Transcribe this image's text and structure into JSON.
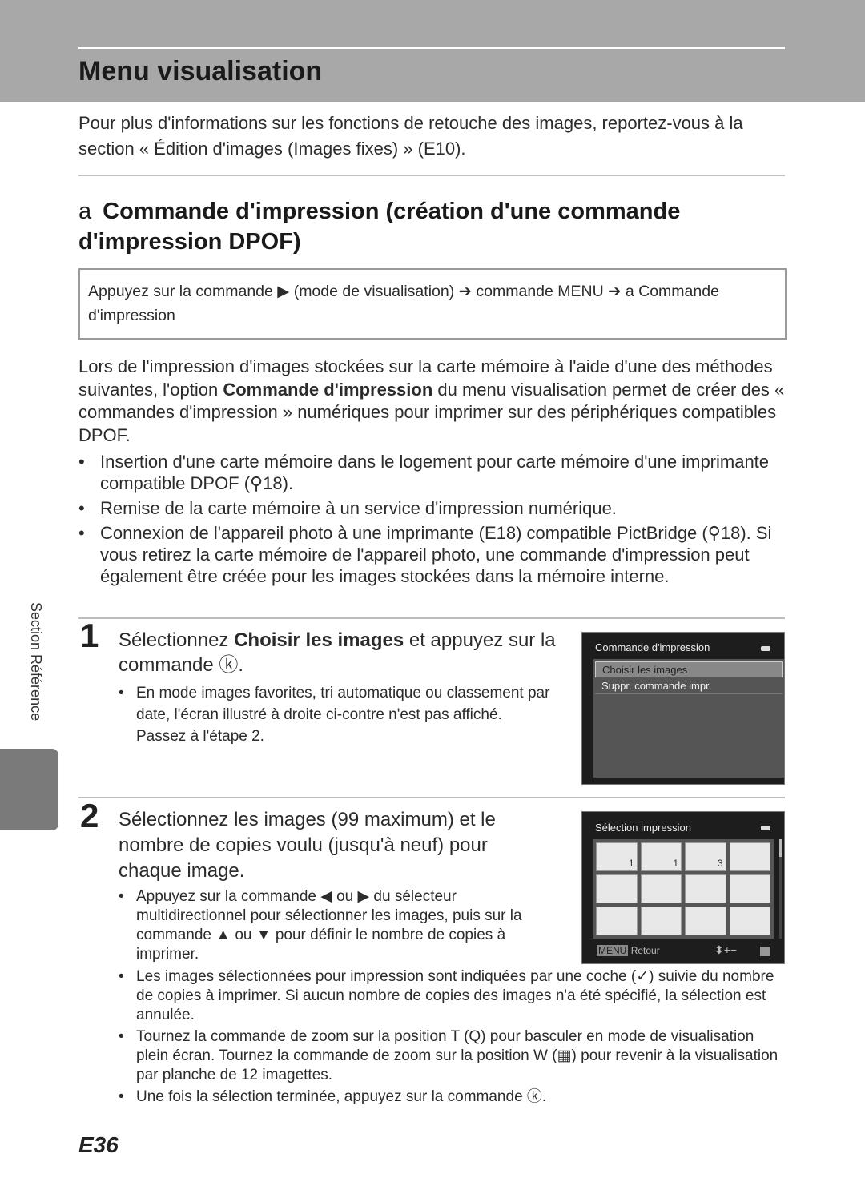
{
  "header": {
    "title": "Menu visualisation"
  },
  "intro": "Pour plus d'informations sur les fonctions de retouche des images, reportez-vous à la section « Édition d'images (Images fixes) » (E10).",
  "section": {
    "icon": "a",
    "title": "Commande d'impression (création d'une commande d'impression DPOF)"
  },
  "path_box": {
    "text": "Appuyez sur la commande ▶ (mode de visualisation) ➔ commande MENU ➔ a  Commande d'impression"
  },
  "desc": {
    "pre": "Lors de l'impression d'images stockées sur la carte mémoire à l'aide d'une des méthodes suivantes, l'option ",
    "bold": "Commande d'impression",
    "post": " du menu visualisation permet de créer des « commandes d'impression » numériques pour imprimer sur des périphériques compatibles DPOF."
  },
  "bullets": [
    "Insertion d'une carte mémoire dans le logement pour carte mémoire d'une imprimante compatible DPOF (⚲18).",
    "Remise de la carte mémoire à un service d'impression numérique.",
    "Connexion de l'appareil photo à une imprimante (E18) compatible PictBridge (⚲18). Si vous retirez la carte mémoire de l'appareil photo, une commande d'impression peut également être créée pour les images stockées dans la mémoire interne."
  ],
  "side_label": "Section Référence",
  "step1": {
    "num": "1",
    "pre": "Sélectionnez ",
    "bold": "Choisir les images",
    "post": " et appuyez sur la commande ⓚ.",
    "notes": [
      "En mode images favorites, tri automatique ou classement par date, l'écran illustré à droite ci-contre n'est pas affiché. Passez à l'étape 2."
    ],
    "screen": {
      "title": "Commande d'impression",
      "items": [
        "Choisir les images",
        "Suppr. commande impr."
      ]
    }
  },
  "step2": {
    "num": "2",
    "heading": "Sélectionnez les images (99 maximum) et le nombre de copies voulu (jusqu'à neuf) pour chaque image.",
    "notes": [
      "Appuyez sur la commande ◀ ou ▶ du sélecteur multidirectionnel pour sélectionner les images, puis sur la commande ▲ ou ▼ pour définir le nombre de copies à imprimer.",
      "Les images sélectionnées pour impression sont indiquées par une coche (✓) suivie du nombre de copies à imprimer. Si aucun nombre de copies des images n'a été spécifié, la sélection est annulée.",
      "Tournez la commande de zoom sur la position T (Q) pour basculer en mode de visualisation plein écran. Tournez la commande de zoom sur la position W (▦) pour revenir à la visualisation par planche de 12 imagettes.",
      "Une fois la sélection terminée, appuyez sur la commande ⓚ."
    ],
    "screen": {
      "title": "Sélection impression",
      "menu": "MENU",
      "back": "Retour",
      "controls": "⬍+−",
      "copies": [
        "1",
        "1",
        "3"
      ]
    }
  },
  "page_number": "E36"
}
